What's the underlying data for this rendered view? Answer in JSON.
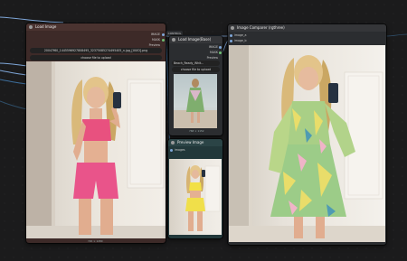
{
  "colors": {
    "canvas": "#1b1b1c",
    "node_brown": "#3d2a28",
    "node_brown_title": "#4a3330",
    "node_dark": "#2b2d30",
    "node_dark_title": "#353639",
    "node_teal": "#22383a",
    "node_teal_title": "#2b4446",
    "wire_blue": "#7fa7d9",
    "wire_dark": "#2f4f6a"
  },
  "load_image_node": {
    "title": "Load Image",
    "outputs": [
      "IMAGE",
      "MASK"
    ],
    "extra_label": "Preview",
    "filename": "20047f60_1445596927808495_32375085274495405_n.jpg_[UUID].png",
    "upload_label": "choose file to upload",
    "size_caption": "720 × 1280"
  },
  "reroute_label": "CONTROL",
  "load_image_small_node": {
    "title": "Load Image(Base)",
    "outputs": [
      "IMAGE",
      "MASK"
    ],
    "extra_label": "Preview",
    "filename": "Beach_Ready_Whit...",
    "upload_label": "choose file to upload",
    "size_caption": "768 × 1152"
  },
  "preview_node": {
    "title": "Preview Image",
    "input": "images"
  },
  "compare_node": {
    "title": "Image Comparer (rgthree)",
    "inputs": [
      "image_a",
      "image_b"
    ]
  }
}
